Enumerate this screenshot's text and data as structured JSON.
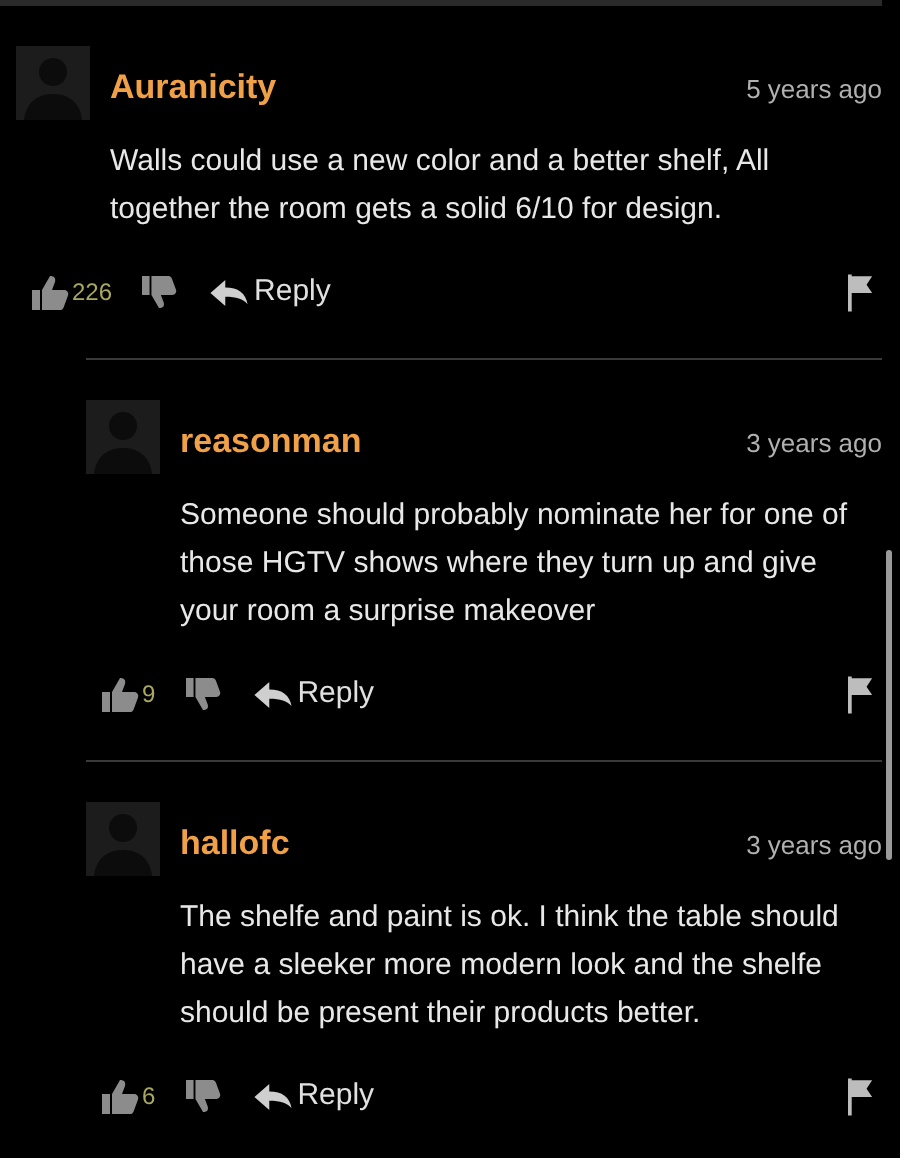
{
  "comments": [
    {
      "author": "Auranicity",
      "time": "5 years ago",
      "text": "Walls could use a new color and a better shelf, All together the room gets a solid 6/10 for design.",
      "likes": "226",
      "reply_label": "Reply",
      "children": [
        {
          "author": "reasonman",
          "time": "3 years ago",
          "text": "Someone should probably nominate her for one of those HGTV shows where they turn up and give your room a surprise makeover",
          "likes": "9",
          "reply_label": "Reply"
        },
        {
          "author": "hallofc",
          "time": "3 years ago",
          "text": "The shelfe and paint is ok. I think the table should have a sleeker more modern look and the shelfe should be present their products better.",
          "likes": "6",
          "reply_label": "Reply"
        }
      ]
    }
  ]
}
